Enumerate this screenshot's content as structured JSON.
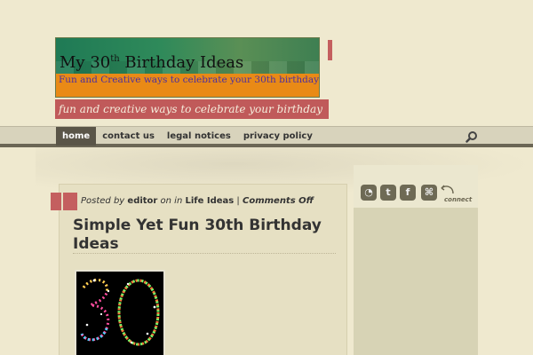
{
  "header": {
    "title_main": "My 30",
    "title_sup": "th",
    "title_end": " Birthday Ideas",
    "banner_subtitle": "Fun and Creative ways to celebrate your 30th birthday",
    "tagline": "fun and creative ways to celebrate your birthday"
  },
  "nav": {
    "items": [
      {
        "label": "home",
        "active": true
      },
      {
        "label": "contact us",
        "active": false
      },
      {
        "label": "legal notices",
        "active": false
      },
      {
        "label": "privacy policy",
        "active": false
      }
    ]
  },
  "post": {
    "posted_by_prefix": "Posted by ",
    "author": "editor",
    "on_in": " on in ",
    "category": "Life Ideas",
    "separator": " | ",
    "comments": "Comments Off",
    "title": "Simple Yet Fun 30th Birthday Ideas"
  },
  "sidebar": {
    "social": [
      {
        "name": "rss-icon",
        "glyph": "◔"
      },
      {
        "name": "twitter-icon",
        "glyph": "t"
      },
      {
        "name": "facebook-icon",
        "glyph": "f"
      },
      {
        "name": "share-icon",
        "glyph": "⌘"
      }
    ],
    "connect_label": "connect"
  },
  "colors": {
    "accent_red": "#c05a5a",
    "nav_active": "#5a5548",
    "banner_orange": "#e98a16",
    "banner_green": "#2f8a5a"
  }
}
